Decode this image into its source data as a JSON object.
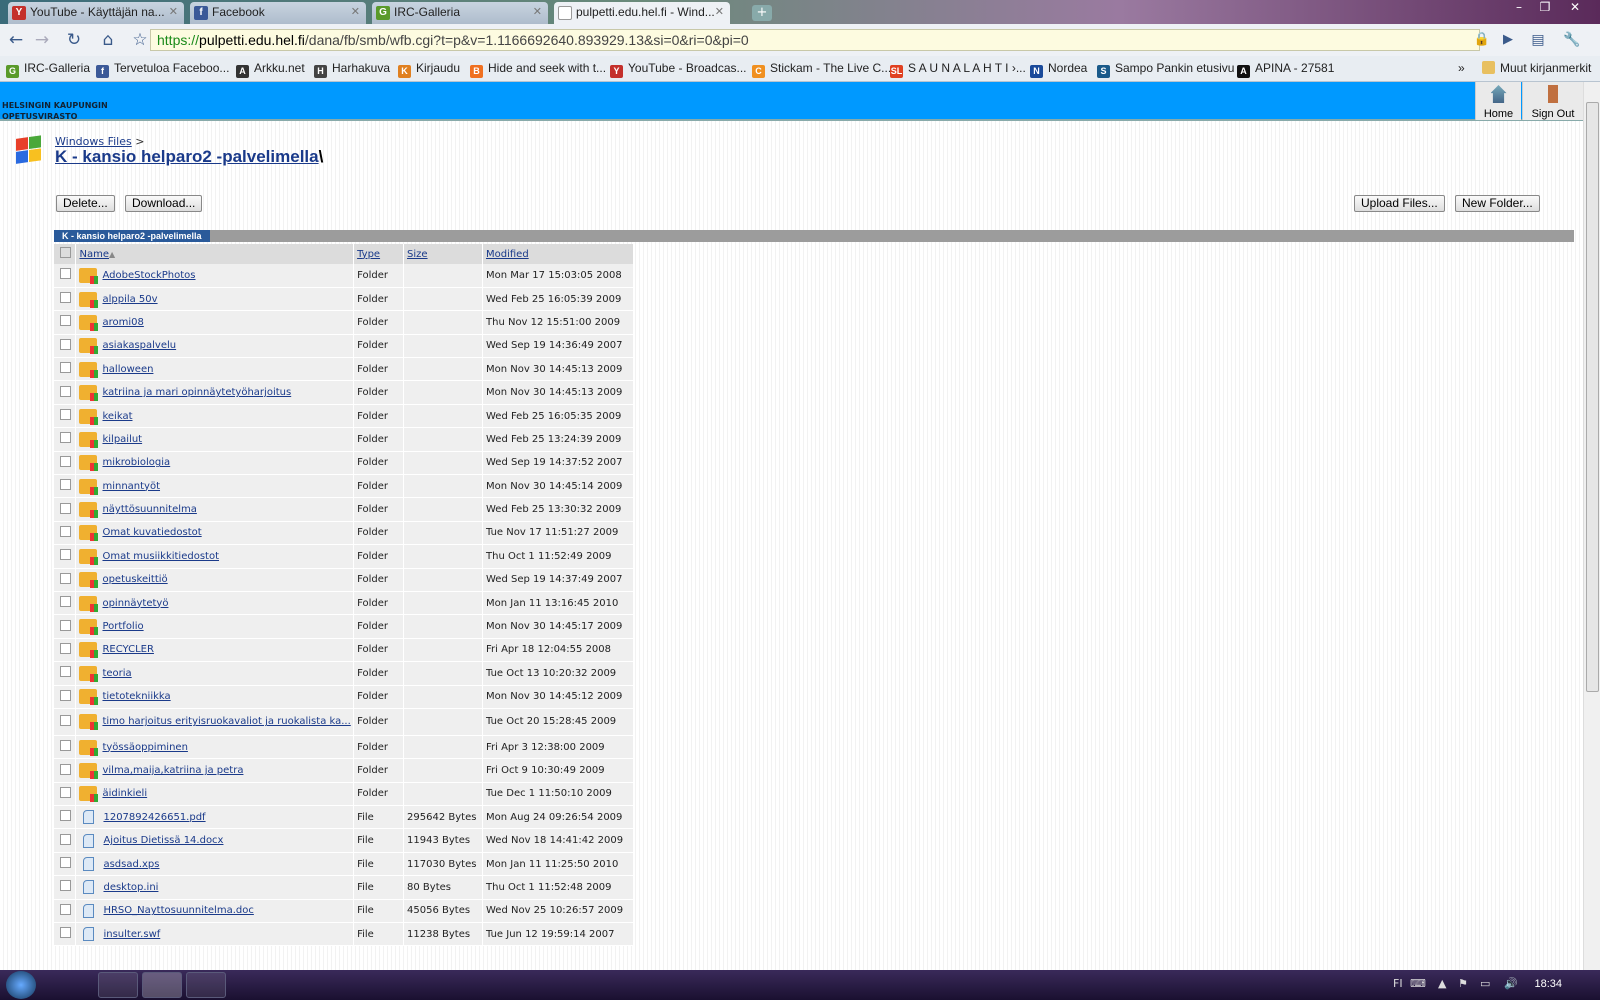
{
  "browser": {
    "tabs": [
      {
        "label": "YouTube - Käyttäjän na...",
        "icon": "youtube-icon",
        "color": "#c4302b",
        "glyph": "Y"
      },
      {
        "label": "Facebook",
        "icon": "facebook-icon",
        "color": "#3b5998",
        "glyph": "f"
      },
      {
        "label": "IRC-Galleria",
        "icon": "irc-galleria-icon",
        "color": "#5a9a2a",
        "glyph": "G"
      },
      {
        "label": "pulpetti.edu.hel.fi - Wind...",
        "icon": "page-icon",
        "color": "#ffffff",
        "glyph": ""
      }
    ],
    "url_scheme": "https://",
    "url_host": "pulpetti.edu.hel.fi",
    "url_path": "/dana/fb/smb/wfb.cgi?t=p&v=1.1166692640.893929.13&si=0&ri=0&pi=0",
    "bookmarks": [
      {
        "label": "IRC-Galleria",
        "color": "#5a9a2a",
        "glyph": "G"
      },
      {
        "label": "Tervetuloa Faceboo...",
        "color": "#3b5998",
        "glyph": "f"
      },
      {
        "label": "Arkku.net",
        "color": "#333",
        "glyph": "A"
      },
      {
        "label": "Harhakuva",
        "color": "#444",
        "glyph": "H"
      },
      {
        "label": "Kirjaudu",
        "color": "#e08020",
        "glyph": "K"
      },
      {
        "label": "Hide and seek with t...",
        "color": "#f07020",
        "glyph": "B"
      },
      {
        "label": "YouTube - Broadcas...",
        "color": "#c4302b",
        "glyph": "Y"
      },
      {
        "label": "Stickam - The Live C...",
        "color": "#f09020",
        "glyph": "C"
      },
      {
        "label": "S A U N A L A H T I ›...",
        "color": "#e04020",
        "glyph": "SL"
      },
      {
        "label": "Nordea",
        "color": "#1a4a9a",
        "glyph": "N"
      },
      {
        "label": "Sampo Pankin etusivu",
        "color": "#1a5a8a",
        "glyph": "S"
      },
      {
        "label": "APINA - 27581",
        "color": "#111",
        "glyph": "A"
      }
    ],
    "other_bookmarks": "Muut kirjanmerkit",
    "overflow": "»"
  },
  "header": {
    "org_line1": "HELSINGIN KAUPUNGIN",
    "org_line2": "OPETUSVIRASTO",
    "home": "Home",
    "sign_out": "Sign Out"
  },
  "page": {
    "breadcrumb": "Windows Files",
    "breadcrumb_sep": ">",
    "title": "K - kansio helparo2 -palvelimella",
    "title_suffix": "\\",
    "buttons": {
      "delete": "Delete...",
      "download": "Download...",
      "upload": "Upload Files...",
      "new_folder": "New Folder..."
    },
    "grid_label": "K - kansio helparo2 -palvelimella",
    "columns": {
      "name": "Name",
      "sort_indicator": "▲",
      "type": "Type",
      "size": "Size",
      "modified": "Modified"
    },
    "rows": [
      {
        "name": "AdobeStockPhotos",
        "type": "Folder",
        "size": "",
        "modified": "Mon Mar 17 15:03:05 2008"
      },
      {
        "name": "alppila 50v",
        "type": "Folder",
        "size": "",
        "modified": "Wed Feb 25 16:05:39 2009"
      },
      {
        "name": "aromi08",
        "type": "Folder",
        "size": "",
        "modified": "Thu Nov 12 15:51:00 2009"
      },
      {
        "name": "asiakaspalvelu",
        "type": "Folder",
        "size": "",
        "modified": "Wed Sep 19 14:36:49 2007"
      },
      {
        "name": "halloween",
        "type": "Folder",
        "size": "",
        "modified": "Mon Nov 30 14:45:13 2009"
      },
      {
        "name": "katriina ja mari opinnäytetyöharjoitus",
        "type": "Folder",
        "size": "",
        "modified": "Mon Nov 30 14:45:13 2009"
      },
      {
        "name": "keikat",
        "type": "Folder",
        "size": "",
        "modified": "Wed Feb 25 16:05:35 2009"
      },
      {
        "name": "kilpailut",
        "type": "Folder",
        "size": "",
        "modified": "Wed Feb 25 13:24:39 2009"
      },
      {
        "name": "mikrobiologia",
        "type": "Folder",
        "size": "",
        "modified": "Wed Sep 19 14:37:52 2007"
      },
      {
        "name": "minnantyöt",
        "type": "Folder",
        "size": "",
        "modified": "Mon Nov 30 14:45:14 2009"
      },
      {
        "name": "näyttösuunnitelma",
        "type": "Folder",
        "size": "",
        "modified": "Wed Feb 25 13:30:32 2009"
      },
      {
        "name": "Omat kuvatiedostot",
        "type": "Folder",
        "size": "",
        "modified": "Tue Nov 17 11:51:27 2009"
      },
      {
        "name": "Omat musiikkitiedostot",
        "type": "Folder",
        "size": "",
        "modified": "Thu Oct 1 11:52:49 2009"
      },
      {
        "name": "opetuskeittiö",
        "type": "Folder",
        "size": "",
        "modified": "Wed Sep 19 14:37:49 2007"
      },
      {
        "name": "opinnäytetyö",
        "type": "Folder",
        "size": "",
        "modified": "Mon Jan 11 13:16:45 2010"
      },
      {
        "name": "Portfolio",
        "type": "Folder",
        "size": "",
        "modified": "Mon Nov 30 14:45:17 2009"
      },
      {
        "name": "RECYCLER",
        "type": "Folder",
        "size": "",
        "modified": "Fri Apr 18 12:04:55 2008"
      },
      {
        "name": "teoria",
        "type": "Folder",
        "size": "",
        "modified": "Tue Oct 13 10:20:32 2009"
      },
      {
        "name": "tietotekniikka",
        "type": "Folder",
        "size": "",
        "modified": "Mon Nov 30 14:45:12 2009"
      },
      {
        "name": "timo harjoitus erityisruokavaliot ja ruokalista ka...",
        "type": "Folder",
        "size": "",
        "modified": "Tue Oct 20 15:28:45 2009"
      },
      {
        "name": "työssäoppiminen",
        "type": "Folder",
        "size": "",
        "modified": "Fri Apr 3 12:38:00 2009"
      },
      {
        "name": "vilma,maija,katriina ja petra",
        "type": "Folder",
        "size": "",
        "modified": "Fri Oct 9 10:30:49 2009"
      },
      {
        "name": "äidinkieli",
        "type": "Folder",
        "size": "",
        "modified": "Tue Dec 1 11:50:10 2009"
      },
      {
        "name": "1207892426651.pdf",
        "type": "File",
        "size": "295642 Bytes",
        "modified": "Mon Aug 24 09:26:54 2009"
      },
      {
        "name": "Ajoitus Dietissä 14.docx",
        "type": "File",
        "size": "11943 Bytes",
        "modified": "Wed Nov 18 14:41:42 2009"
      },
      {
        "name": "asdsad.xps",
        "type": "File",
        "size": "117030 Bytes",
        "modified": "Mon Jan 11 11:25:50 2010"
      },
      {
        "name": "desktop.ini",
        "type": "File",
        "size": "80 Bytes",
        "modified": "Thu Oct 1 11:52:48 2009"
      },
      {
        "name": "HRSO_Nayttosuunnitelma.doc",
        "type": "File",
        "size": "45056 Bytes",
        "modified": "Wed Nov 25 10:26:57 2009"
      },
      {
        "name": "insulter.swf",
        "type": "File",
        "size": "11238 Bytes",
        "modified": "Tue Jun 12 19:59:14 2007"
      }
    ]
  },
  "taskbar": {
    "lang": "FI",
    "clock": "18:34"
  }
}
